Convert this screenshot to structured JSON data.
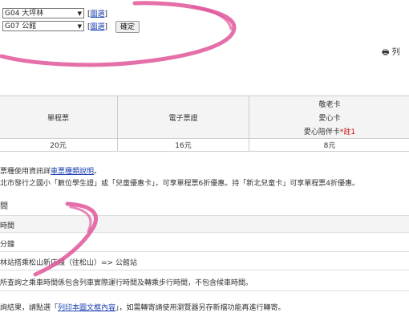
{
  "route_form": {
    "origin_select": "G04 大坪林",
    "destination_select": "G07 公館",
    "map_link": "圖選",
    "confirm_label": "確定"
  },
  "print_label": "列",
  "fare_table": {
    "headers": [
      "單程票",
      "電子票證",
      "敬老卡",
      "愛心卡",
      "愛心陪伴卡",
      "註1"
    ],
    "values": [
      "20元",
      "16元",
      "8元"
    ]
  },
  "notes": {
    "note1_prefix": "票種使用資訊詳",
    "note1_link": "車票種類說明",
    "note1_suffix": "。",
    "note2": "北市發行之國小「數位學生證」或「兒童優惠卡」，可享單程票6折優惠。持「新北兒童卡」可享單程票4折優惠。"
  },
  "time_section": {
    "title": "間",
    "col_header": "時間",
    "duration": "分鐘",
    "route": "林站搭乘松山新店線（往松山）=> 公館站",
    "note": "所查詢之乘車時間係包含列車實際運行時間及轉乘步行時間，不包含候車時間。"
  },
  "footer": {
    "prefix": "詢結果，請點選「",
    "link": "列印本圖文框內容",
    "suffix": "」，如需轉寄請使用瀏覽器另存新檔功能再進行轉寄。"
  },
  "colors": {
    "scribble": "#e0569a",
    "link": "#1a3fb0",
    "required_mark": "#cc0000"
  },
  "icons": {
    "print": "printer-icon"
  }
}
